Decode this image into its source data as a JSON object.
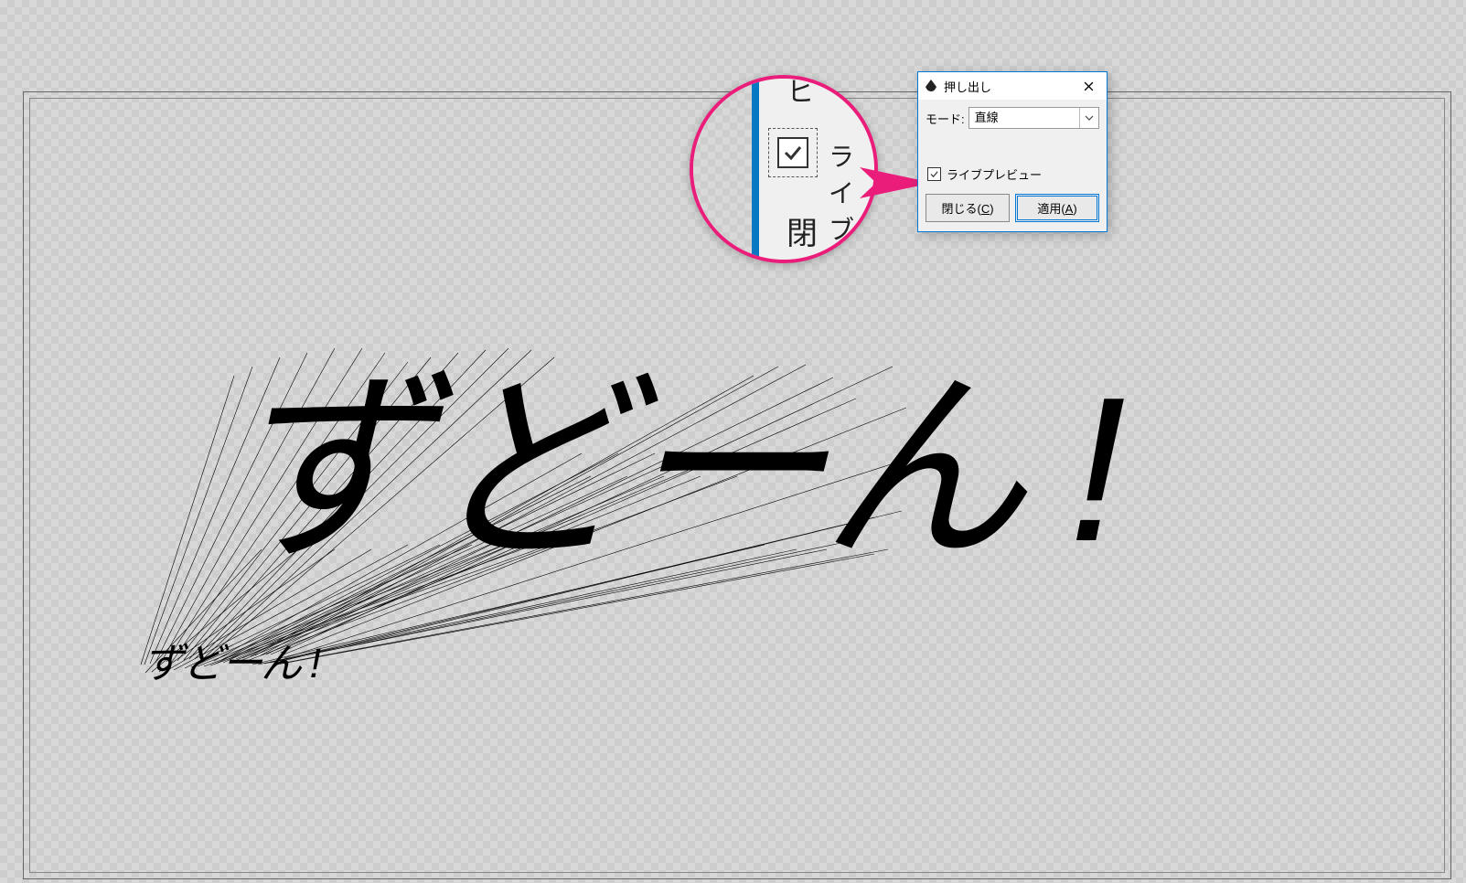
{
  "dialog": {
    "title": "押し出し",
    "mode_label": "モード:",
    "mode_value": "直線",
    "preview_label": "ライブプレビュー",
    "close_btn": "閉じる",
    "close_key": "C",
    "apply_btn": "適用",
    "apply_key": "A"
  },
  "magnifier": {
    "top_fragment": "ヒ",
    "checkbox_label": "ライブ",
    "bottom_fragment": "閉"
  },
  "canvas": {
    "main_text": "ずどーん !",
    "vanish_text": "ずどーん !"
  }
}
